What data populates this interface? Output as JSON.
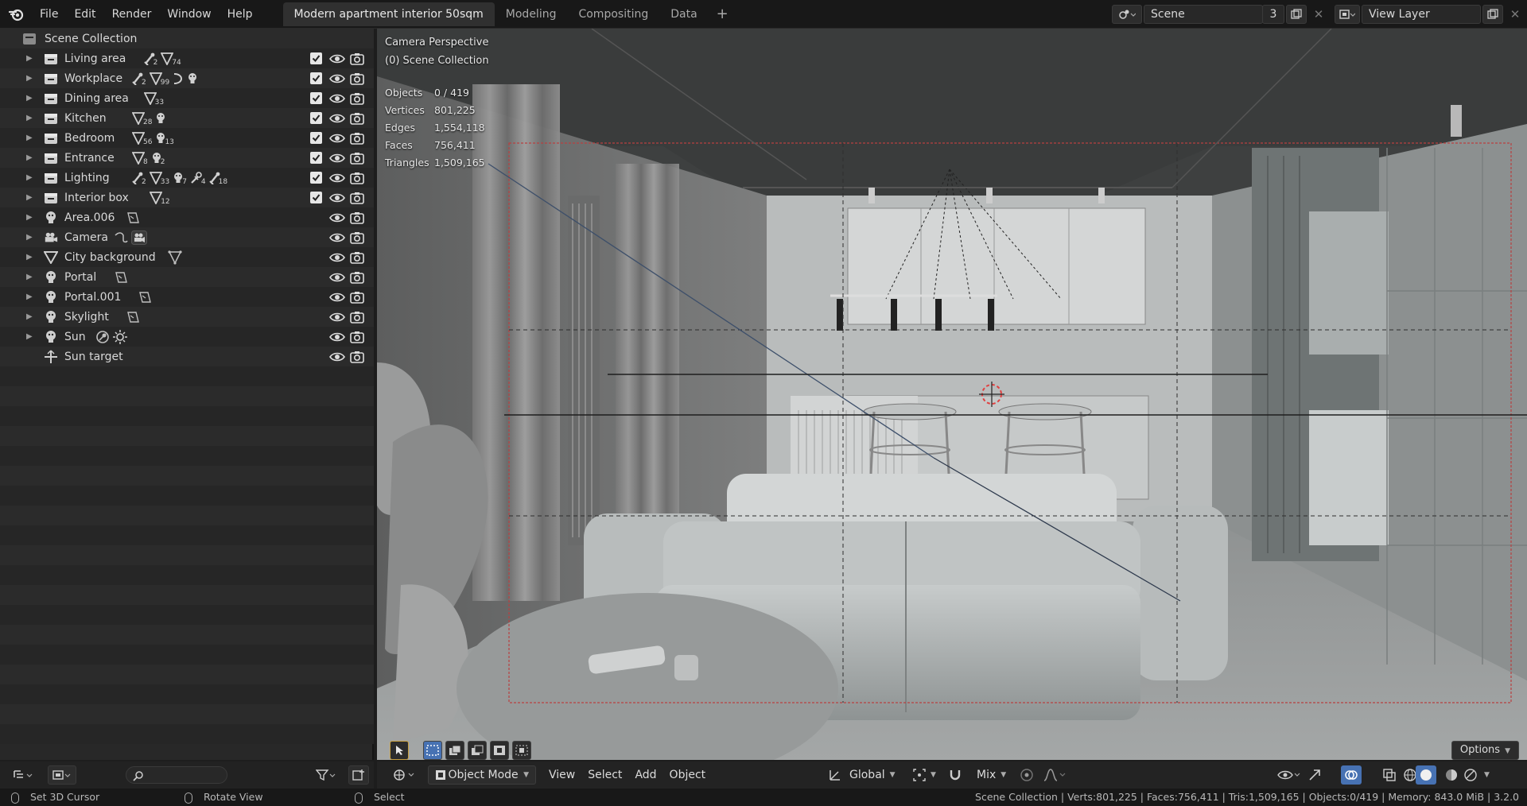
{
  "menu": {
    "items": [
      "File",
      "Edit",
      "Render",
      "Window",
      "Help"
    ]
  },
  "workspaces": {
    "tabs": [
      "Modern apartment interior 50sqm",
      "Modeling",
      "Compositing",
      "Data"
    ],
    "active": 0,
    "add_symbol": "+"
  },
  "scene": {
    "name": "Scene",
    "users": "3",
    "view_layer": "View Layer"
  },
  "outliner": {
    "root": "Scene Collection",
    "rows": [
      {
        "label": "Living area",
        "kind": "collection",
        "badges": [
          [
            "armature",
            "2"
          ],
          [
            "mesh",
            "74"
          ]
        ],
        "checkbox": true
      },
      {
        "label": "Workplace",
        "kind": "collection",
        "badges": [
          [
            "armature",
            "2"
          ],
          [
            "mesh",
            "99"
          ],
          [
            "curve",
            ""
          ],
          [
            "light",
            ""
          ]
        ],
        "checkbox": true
      },
      {
        "label": "Dining area",
        "kind": "collection",
        "badges": [
          [
            "mesh",
            "33"
          ]
        ],
        "checkbox": true
      },
      {
        "label": "Kitchen",
        "kind": "collection",
        "badges": [
          [
            "mesh",
            "28"
          ],
          [
            "light",
            ""
          ]
        ],
        "checkbox": true
      },
      {
        "label": "Bedroom",
        "kind": "collection",
        "badges": [
          [
            "mesh",
            "56"
          ],
          [
            "light",
            "13"
          ]
        ],
        "checkbox": true
      },
      {
        "label": "Entrance",
        "kind": "collection",
        "badges": [
          [
            "mesh",
            "8"
          ],
          [
            "light",
            "2"
          ]
        ],
        "checkbox": true
      },
      {
        "label": "Lighting",
        "kind": "collection",
        "badges": [
          [
            "armature",
            "2"
          ],
          [
            "mesh",
            "33"
          ],
          [
            "light",
            "7"
          ],
          [
            "hook",
            "4"
          ],
          [
            "armature",
            "18"
          ]
        ],
        "checkbox": true
      },
      {
        "label": "Interior box",
        "kind": "collection",
        "badges": [
          [
            "mesh",
            "12"
          ]
        ],
        "checkbox": true
      },
      {
        "label": "Area.006",
        "kind": "light",
        "badges": [
          [
            "lightdata",
            ""
          ]
        ],
        "checkbox": false
      },
      {
        "label": "Camera",
        "kind": "camera",
        "badges": [
          [
            "constraint",
            ""
          ],
          [
            "camdata",
            ""
          ]
        ],
        "checkbox": false
      },
      {
        "label": "City background",
        "kind": "mesh",
        "badges": [
          [
            "meshdata",
            ""
          ]
        ],
        "checkbox": false
      },
      {
        "label": "Portal",
        "kind": "light",
        "badges": [
          [
            "lightdata",
            ""
          ]
        ],
        "checkbox": false
      },
      {
        "label": "Portal.001",
        "kind": "light",
        "badges": [
          [
            "lightdata",
            ""
          ]
        ],
        "checkbox": false
      },
      {
        "label": "Skylight",
        "kind": "light",
        "badges": [
          [
            "lightdata",
            ""
          ]
        ],
        "checkbox": false
      },
      {
        "label": "Sun",
        "kind": "light",
        "badges": [
          [
            "modifier",
            ""
          ],
          [
            "sun",
            ""
          ]
        ],
        "checkbox": false
      },
      {
        "label": "Sun target",
        "kind": "empty",
        "badges": [],
        "checkbox": false
      }
    ]
  },
  "viewport": {
    "title": "Camera Perspective",
    "subtitle": "(0) Scene Collection",
    "stats": [
      {
        "k": "Objects",
        "v": "0 / 419"
      },
      {
        "k": "Vertices",
        "v": "801,225"
      },
      {
        "k": "Edges",
        "v": "1,554,118"
      },
      {
        "k": "Faces",
        "v": "756,411"
      },
      {
        "k": "Triangles",
        "v": "1,509,165"
      }
    ],
    "options_label": "Options"
  },
  "viewport_header": {
    "mode": "Object Mode",
    "menus": [
      "View",
      "Select",
      "Add",
      "Object"
    ],
    "orientation": "Global",
    "snap": "Mix"
  },
  "statusbar": {
    "left": "Set 3D Cursor",
    "middle": "Rotate View",
    "right_action": "Select",
    "info": "Scene Collection | Verts:801,225 | Faces:756,411 | Tris:1,509,165 | Objects:0/419 | Memory: 843.0 MiB | 3.2.0"
  },
  "colors": {
    "accent": "#4772b3",
    "camera_frame": "#b84040"
  }
}
